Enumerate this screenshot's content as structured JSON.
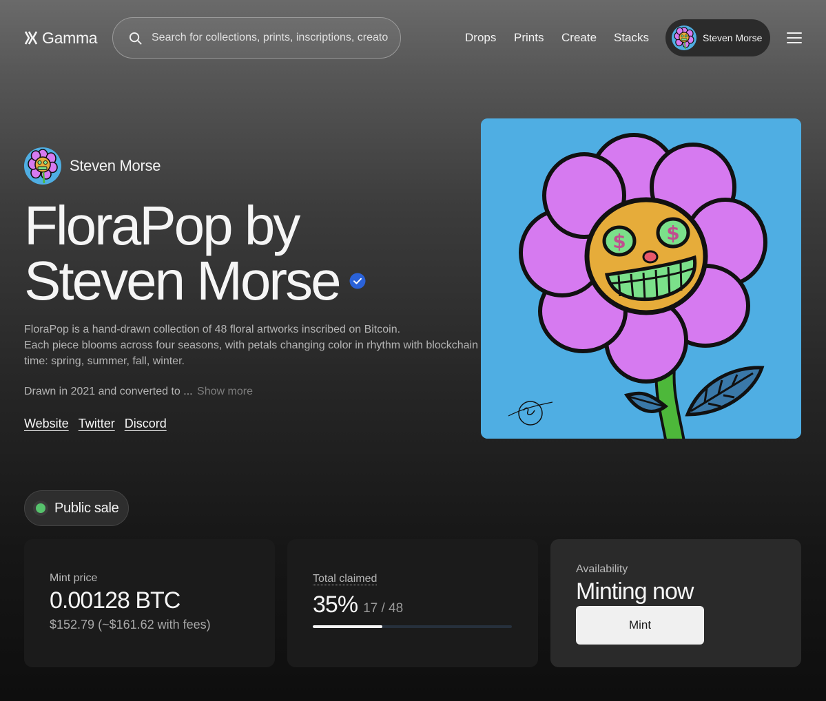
{
  "header": {
    "logo_text": "Gamma",
    "search_placeholder": "Search for collections, prints, inscriptions, creato",
    "nav": [
      "Drops",
      "Prints",
      "Create",
      "Stacks"
    ],
    "user_name": "Steven Morse"
  },
  "hero": {
    "creator_name": "Steven Morse",
    "title_line1": "FloraPop by",
    "title_line2": "Steven Morse",
    "description_line1": "FloraPop is a hand-drawn collection of 48 floral artworks inscribed on Bitcoin.",
    "description_line2": "Each piece blooms across four seasons, with petals changing color in rhythm with blockchain time: spring, summer, fall, winter.",
    "description_more": "Drawn in 2021 and converted to ...",
    "show_more": "Show more",
    "links": [
      "Website",
      "Twitter",
      "Discord"
    ]
  },
  "sale": {
    "status_label": "Public sale",
    "status_color": "#56c26c",
    "mint_price_label": "Mint price",
    "mint_price_value": "0.00128 BTC",
    "mint_price_usd": "$152.79 (~$161.62 with fees)",
    "claimed_label": "Total claimed",
    "claimed_percent_text": "35%",
    "claimed_count": "17 / 48",
    "claimed_fraction": 0.35,
    "availability_label": "Availability",
    "availability_value": "Minting now",
    "mint_button": "Mint"
  },
  "colors": {
    "artwork_bg": "#4faee3",
    "petal": "#d67af0",
    "face": "#e6ac3a",
    "verified_badge": "#2a62d9"
  }
}
